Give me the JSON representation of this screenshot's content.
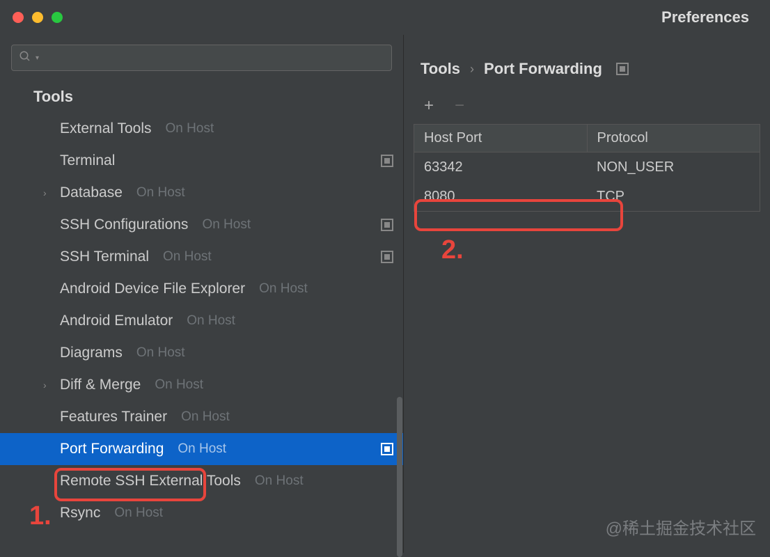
{
  "window": {
    "title": "Preferences"
  },
  "sidebar": {
    "category_label": "Tools",
    "hint_text": "On Host",
    "items": [
      {
        "label": "External Tools",
        "hint": true,
        "type": "child",
        "collapse": false
      },
      {
        "label": "Terminal",
        "hint": false,
        "type": "child",
        "collapse": true
      },
      {
        "label": "Database",
        "hint": true,
        "type": "expandable",
        "collapse": false
      },
      {
        "label": "SSH Configurations",
        "hint": true,
        "type": "child",
        "collapse": true
      },
      {
        "label": "SSH Terminal",
        "hint": true,
        "type": "child",
        "collapse": true
      },
      {
        "label": "Android Device File Explorer",
        "hint": true,
        "type": "child",
        "collapse": false
      },
      {
        "label": "Android Emulator",
        "hint": true,
        "type": "child",
        "collapse": false
      },
      {
        "label": "Diagrams",
        "hint": true,
        "type": "child",
        "collapse": false
      },
      {
        "label": "Diff & Merge",
        "hint": true,
        "type": "expandable",
        "collapse": false
      },
      {
        "label": "Features Trainer",
        "hint": true,
        "type": "child",
        "collapse": false
      },
      {
        "label": "Port Forwarding",
        "hint": true,
        "type": "child",
        "collapse": true,
        "selected": true
      },
      {
        "label": "Remote SSH External Tools",
        "hint": true,
        "type": "child",
        "collapse": false
      },
      {
        "label": "Rsync",
        "hint": true,
        "type": "child",
        "collapse": false
      }
    ]
  },
  "breadcrumb": {
    "parent": "Tools",
    "current": "Port Forwarding"
  },
  "table": {
    "headers": [
      "Host Port",
      "Protocol"
    ],
    "rows": [
      {
        "port": "63342",
        "protocol": "NON_USER"
      },
      {
        "port": "8080",
        "protocol": "TCP"
      }
    ]
  },
  "annotations": {
    "label1": "1.",
    "label2": "2."
  },
  "watermark": "@稀土掘金技术社区"
}
